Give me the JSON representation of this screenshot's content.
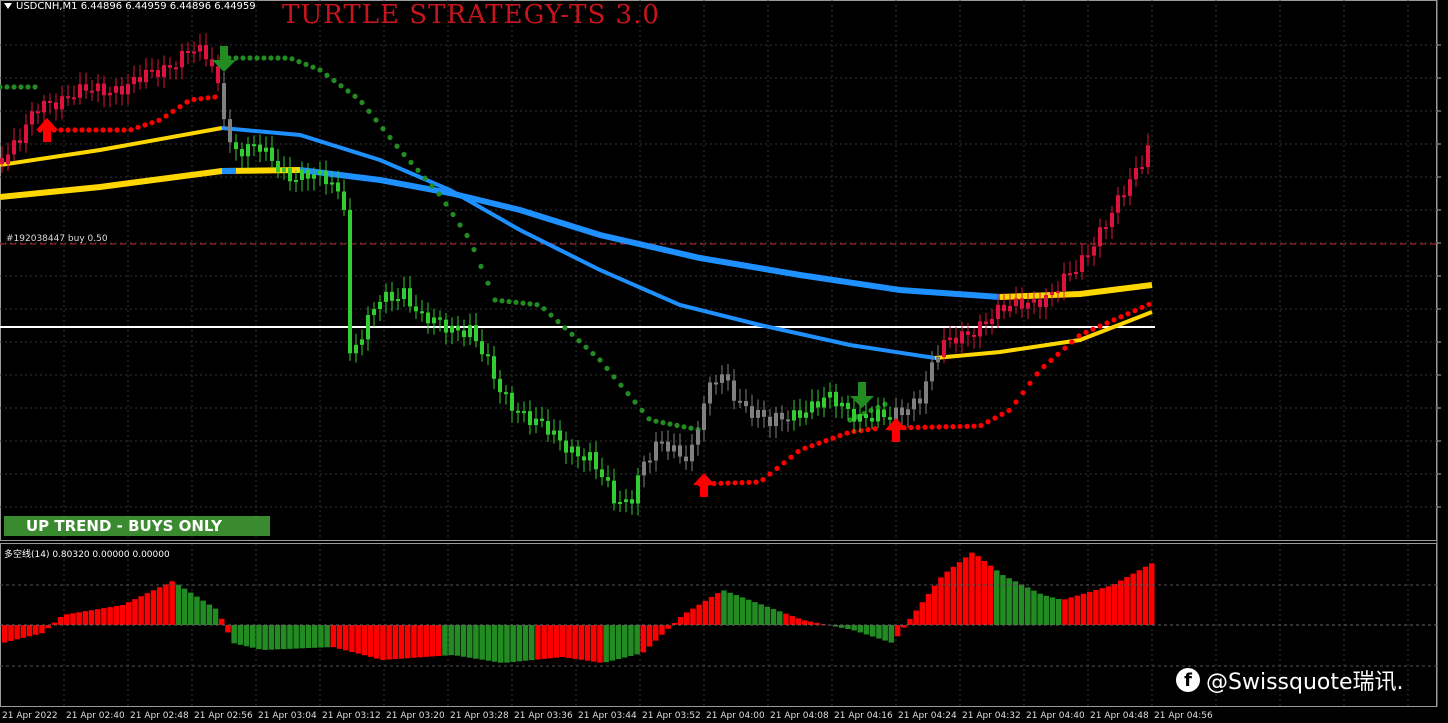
{
  "header": {
    "symbol_info": "USDCNH,M1  6.44896 6.44959 6.44896 6.44959"
  },
  "title": "TURTLE STRATEGY-TS 3.0",
  "order_label": "#192038447 buy 0.50",
  "trend_banner": "UP TREND - BUYS ONLY",
  "indicator_label": "多空线(14) 0.80320 0.00000 0.00000",
  "x_axis_labels": [
    "21 Apr 2022",
    "21 Apr 02:40",
    "21 Apr 02:48",
    "21 Apr 02:56",
    "21 Apr 03:04",
    "21 Apr 03:12",
    "21 Apr 03:20",
    "21 Apr 03:28",
    "21 Apr 03:36",
    "21 Apr 03:44",
    "21 Apr 03:52",
    "21 Apr 04:00",
    "21 Apr 04:08",
    "21 Apr 04:16",
    "21 Apr 04:24",
    "21 Apr 04:32",
    "21 Apr 04:40",
    "21 Apr 04:48",
    "21 Apr 04:56"
  ],
  "watermark": {
    "icon": "facebook-icon",
    "text": "@Swissquote瑞讯."
  },
  "colors": {
    "bull": "#dc143c",
    "bear": "#32cd32",
    "neutral": "#808080",
    "ma_blue": "#1e90ff",
    "ma_yellow": "#ffd700",
    "trail_green": "#228b22",
    "trail_red": "#ff0000",
    "hist_red": "#ff0000",
    "hist_green": "#228b22"
  },
  "chart_data": {
    "type": "candlestick",
    "signals": [
      {
        "kind": "buy",
        "icon": "up-arrow-icon"
      },
      {
        "kind": "sell",
        "icon": "down-arrow-icon"
      },
      {
        "kind": "buy",
        "icon": "up-arrow-icon"
      },
      {
        "kind": "sell",
        "icon": "down-arrow-icon"
      },
      {
        "kind": "buy",
        "icon": "up-arrow-icon"
      }
    ]
  }
}
